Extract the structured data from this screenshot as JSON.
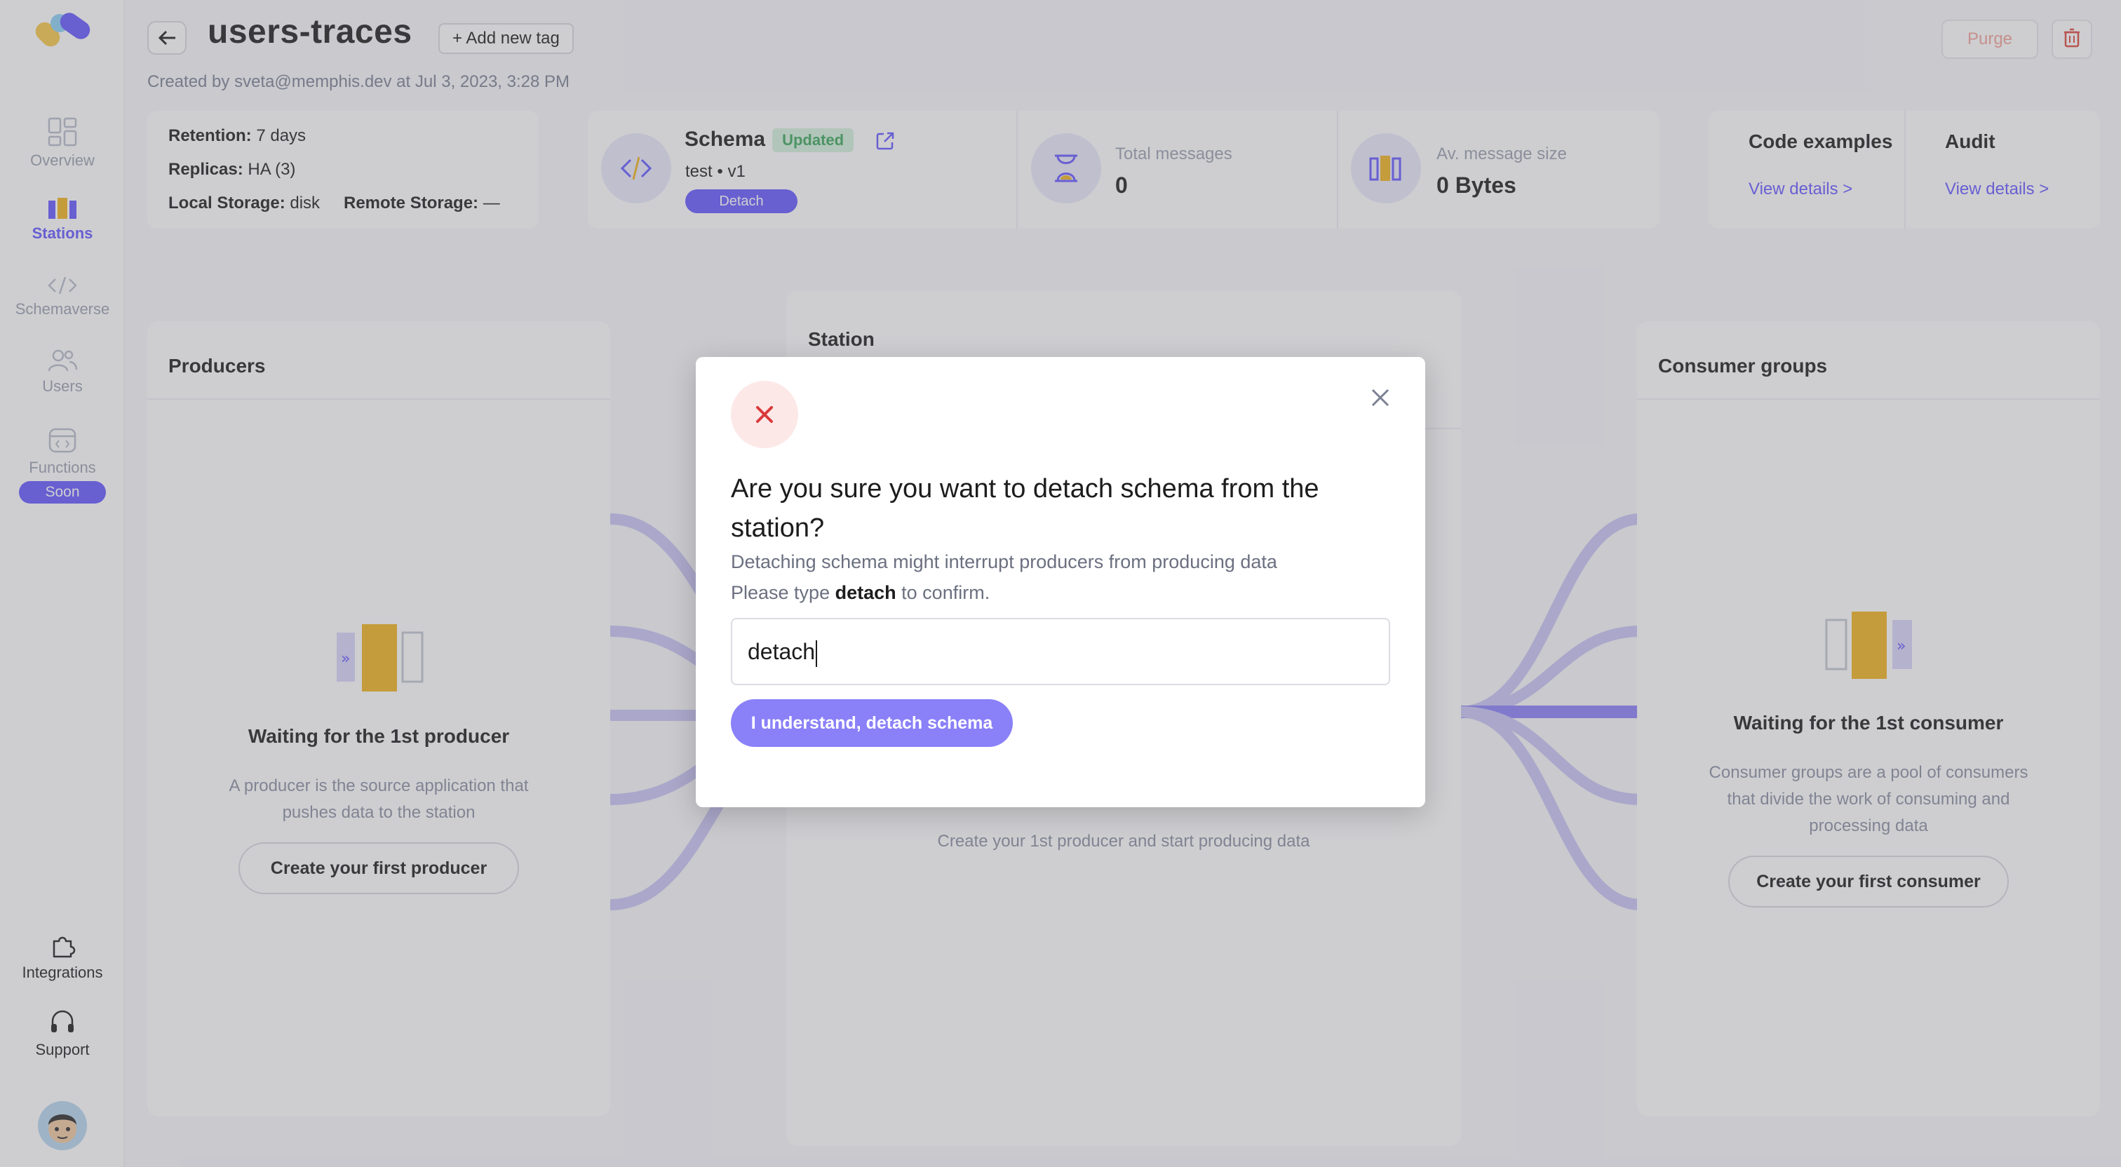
{
  "sidebar": {
    "items": [
      {
        "label": "Overview",
        "icon": "overview-icon"
      },
      {
        "label": "Stations",
        "icon": "stations-icon"
      },
      {
        "label": "Schemaverse",
        "icon": "code-icon"
      },
      {
        "label": "Users",
        "icon": "users-icon"
      },
      {
        "label": "Functions",
        "icon": "functions-icon",
        "badge": "Soon"
      }
    ],
    "bottom": [
      {
        "label": "Integrations",
        "icon": "puzzle-icon"
      },
      {
        "label": "Support",
        "icon": "headset-icon"
      }
    ],
    "accent": "#6557ff"
  },
  "header": {
    "title": "users-traces",
    "add_tag": "+ Add new tag",
    "created": "Created by sveta@memphis.dev at Jul 3, 2023, 3:28 PM",
    "purge": "Purge"
  },
  "station_info": {
    "retention_label": "Retention:",
    "retention_value": "7 days",
    "replicas_label": "Replicas:",
    "replicas_value": "HA (3)",
    "local_storage_label": "Local Storage:",
    "local_storage_value": "disk",
    "remote_storage_label": "Remote Storage:",
    "remote_storage_value": "—"
  },
  "schema_card": {
    "title": "Schema",
    "status": "Updated",
    "name": "test",
    "version": "v1",
    "detach": "Detach"
  },
  "stats": {
    "total_messages_label": "Total messages",
    "total_messages_value": "0",
    "avg_size_label": "Av. message size",
    "avg_size_value": "0 Bytes"
  },
  "links": {
    "code_examples_title": "Code examples",
    "code_examples_link": "View details >",
    "audit_title": "Audit",
    "audit_link": "View details >"
  },
  "producers": {
    "title": "Producers",
    "wait_title": "Waiting for the 1st producer",
    "wait_desc_1": "A producer is the source application that",
    "wait_desc_2": "pushes data to the station",
    "button": "Create your first producer"
  },
  "station_panel": {
    "title": "Station",
    "hint": "Create your 1st producer and start producing data"
  },
  "consumers": {
    "title": "Consumer groups",
    "wait_title": "Waiting for the 1st consumer",
    "wait_desc_1": "Consumer groups are a pool of consumers",
    "wait_desc_2": "that divide the work of consuming and",
    "wait_desc_3": "processing data",
    "button": "Create your first consumer"
  },
  "modal": {
    "title": "Are you sure you want to detach schema from the station?",
    "description": "Detaching schema might interrupt producers from producing data",
    "confirm_prefix": "Please type",
    "confirm_keyword": "detach",
    "confirm_suffix": "to confirm.",
    "input_value": "detach",
    "button": "I understand, detach schema"
  }
}
